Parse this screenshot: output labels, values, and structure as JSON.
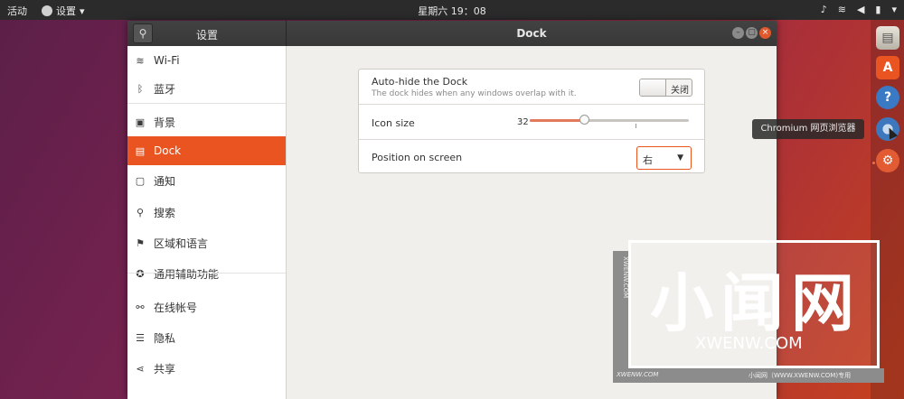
{
  "topbar": {
    "activities": "活动",
    "app_menu": "设置",
    "clock": "星期六 19：08"
  },
  "window": {
    "sidebar_title": "设置",
    "main_title": "Dock",
    "controls": {
      "min": "–",
      "max": "▢",
      "close": "×"
    }
  },
  "sidebar": {
    "items": [
      {
        "label": "Wi-Fi",
        "icon": "wifi-icon",
        "glyph": "≋"
      },
      {
        "label": "蓝牙",
        "icon": "bluetooth-icon",
        "glyph": "ᛒ"
      },
      {
        "label": "背景",
        "icon": "background-icon",
        "glyph": "▣"
      },
      {
        "label": "Dock",
        "icon": "dock-icon",
        "glyph": "▤",
        "active": true
      },
      {
        "label": "通知",
        "icon": "notifications-icon",
        "glyph": "▢"
      },
      {
        "label": "搜索",
        "icon": "search-icon",
        "glyph": "⚲"
      },
      {
        "label": "区域和语言",
        "icon": "region-icon",
        "glyph": "⚑"
      },
      {
        "label": "通用辅助功能",
        "icon": "accessibility-icon",
        "glyph": "✪"
      },
      {
        "label": "在线帐号",
        "icon": "online-accounts-icon",
        "glyph": "⚯"
      },
      {
        "label": "隐私",
        "icon": "privacy-icon",
        "glyph": "☰"
      },
      {
        "label": "共享",
        "icon": "share-icon",
        "glyph": "⋖"
      }
    ]
  },
  "dock_settings": {
    "autohide": {
      "title": "Auto-hide the Dock",
      "subtitle": "The dock hides when any windows overlap with it.",
      "state_label": "关闭",
      "enabled": false
    },
    "icon_size": {
      "title": "Icon size",
      "value": "32",
      "level": 0.34
    },
    "position": {
      "title": "Position on screen",
      "selected": "右"
    }
  },
  "dock": {
    "tooltip": "Chromium 网页浏览器"
  },
  "watermark": {
    "big": "小闻网",
    "url": "XWENW.COM",
    "side": "XWENW.COM",
    "bottom_left": "XWENW.COM",
    "bottom_right": "小闻网（WWW.XWENW.COM)专用"
  }
}
